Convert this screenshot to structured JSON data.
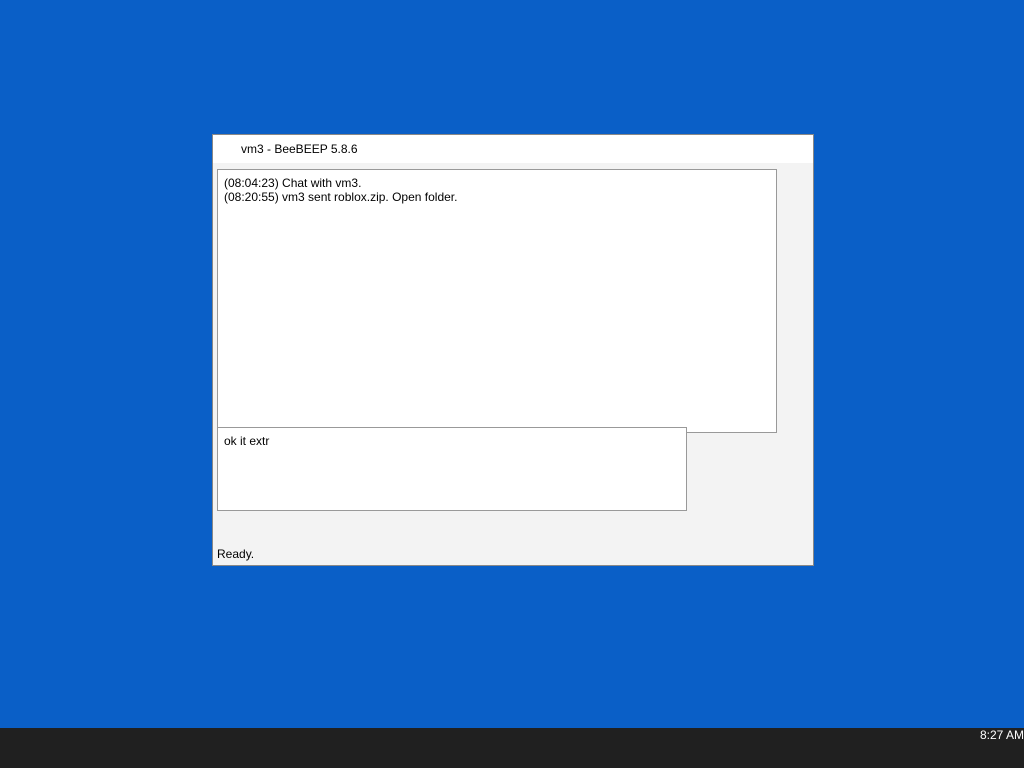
{
  "title": "vm3 - BeeBEEP 5.8.6",
  "lines": [
    "(08:04:23) Chat with vm3.",
    "(08:20:55) vm3 sent roblox.zip. Open folder."
  ],
  "input": "ok it extr",
  "status": "Ready.",
  "time": "8:27 AM"
}
